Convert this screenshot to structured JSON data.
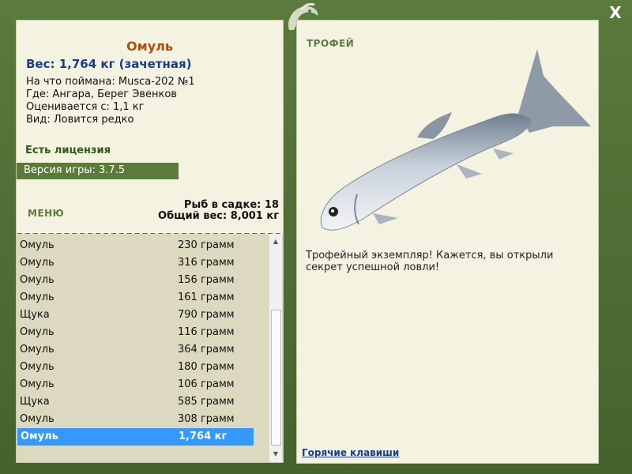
{
  "window": {
    "close_label": "X"
  },
  "fish_card": {
    "name": "Омуль",
    "weight": "Вес: 1,764 кг (зачетная)",
    "caught_on": "На что поймана: Musca-202 №1",
    "location": "Где: Ангара, Берег Эвенков",
    "valued_from": "Оценивается с: 1,1 кг",
    "kind": "Вид: Ловится редко",
    "license": "Есть лицензия",
    "version": "Версия игры: 3.7.5"
  },
  "menu": {
    "label": "МЕНЮ"
  },
  "stats": {
    "fish_in_net": "Рыб в садке: 18",
    "total_weight": "Общий вес: 8,001 кг"
  },
  "catch_list": [
    {
      "name": "Омуль",
      "weight": "230 грамм"
    },
    {
      "name": "Омуль",
      "weight": "316 грамм"
    },
    {
      "name": "Омуль",
      "weight": "156 грамм"
    },
    {
      "name": "Омуль",
      "weight": "161 грамм"
    },
    {
      "name": "Щука",
      "weight": "790 грамм"
    },
    {
      "name": "Омуль",
      "weight": "116 грамм"
    },
    {
      "name": "Омуль",
      "weight": "364 грамм"
    },
    {
      "name": "Омуль",
      "weight": "180 грамм"
    },
    {
      "name": "Омуль",
      "weight": "106 грамм"
    },
    {
      "name": "Щука",
      "weight": "585 грамм"
    },
    {
      "name": "Омуль",
      "weight": "308 грамм"
    },
    {
      "name": "Омуль",
      "weight": "1,764 кг"
    }
  ],
  "selected_row": 11,
  "trophy": {
    "label": "ТРОФЕЙ",
    "description": "Трофейный экземпляр! Кажется, вы открыли секрет успешной ловли!"
  },
  "hotkeys_label": "Горячие клавиши",
  "colors": {
    "accent": "#5a7a3e",
    "fish_name": "#b54a0f",
    "weight": "#1c3a8a",
    "selection": "#3399ff"
  }
}
